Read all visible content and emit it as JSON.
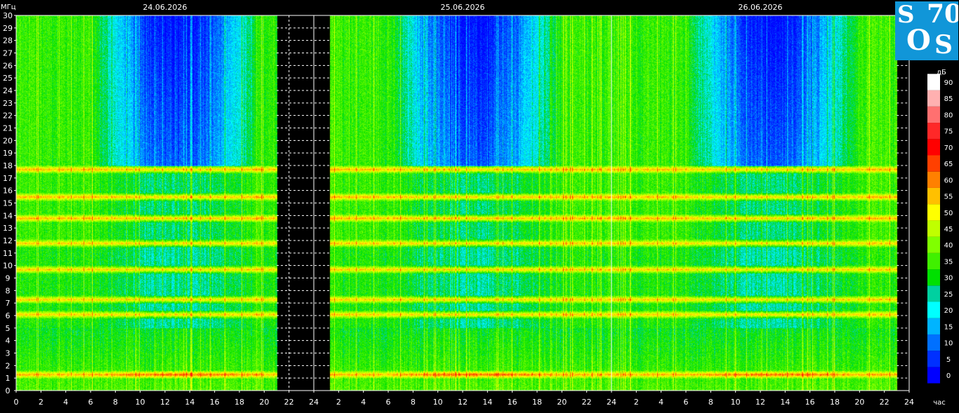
{
  "chart_data": {
    "type": "heatmap",
    "ylabel": "МГц",
    "xlabel": "час",
    "colorbar_label": "дБ",
    "dates": [
      "24.06.2026",
      "25.06.2026",
      "26.06.2026"
    ],
    "ylim": [
      0,
      30
    ],
    "y_ticks": [
      "0",
      "1",
      "2",
      "3",
      "4",
      "5",
      "6",
      "7",
      "8",
      "9",
      "10",
      "11",
      "12",
      "13",
      "14",
      "15",
      "16",
      "17",
      "18",
      "19",
      "20",
      "21",
      "22",
      "23",
      "24",
      "25",
      "26",
      "27",
      "28",
      "29",
      "30"
    ],
    "x_tick_labels": [
      "0",
      "2",
      "4",
      "6",
      "8",
      "10",
      "12",
      "14",
      "16",
      "18",
      "20",
      "22",
      "24",
      "2",
      "4",
      "6",
      "8",
      "10",
      "12",
      "14",
      "16",
      "18",
      "20",
      "22",
      "24",
      "2",
      "4",
      "6",
      "8",
      "10",
      "12",
      "14",
      "16",
      "18",
      "20",
      "22",
      "24"
    ],
    "x_range_hours": [
      0,
      72
    ],
    "data_segments_hours": [
      [
        0,
        21
      ],
      [
        25.3,
        71
      ]
    ],
    "colorbar": {
      "ticks": [
        "0",
        "5",
        "10",
        "15",
        "20",
        "25",
        "30",
        "35",
        "40",
        "45",
        "50",
        "55",
        "60",
        "65",
        "70",
        "75",
        "80",
        "85",
        "90"
      ],
      "colors": [
        "#0000ff",
        "#0030ff",
        "#0070ff",
        "#00b4ff",
        "#00ffff",
        "#00d0a0",
        "#00e000",
        "#40f000",
        "#80ff00",
        "#c0ff00",
        "#ffff00",
        "#ffc000",
        "#ff8000",
        "#ff4000",
        "#ff0000",
        "#ff2828",
        "#ff7070",
        "#ffb0b0",
        "#ffffff"
      ]
    },
    "strong_bands_mhz": [
      1.3,
      6.1,
      7.3,
      9.7,
      11.8,
      13.8,
      15.5,
      17.7
    ],
    "grid": true
  },
  "logo": {
    "letters": [
      "S",
      "70",
      "O",
      "S"
    ]
  }
}
